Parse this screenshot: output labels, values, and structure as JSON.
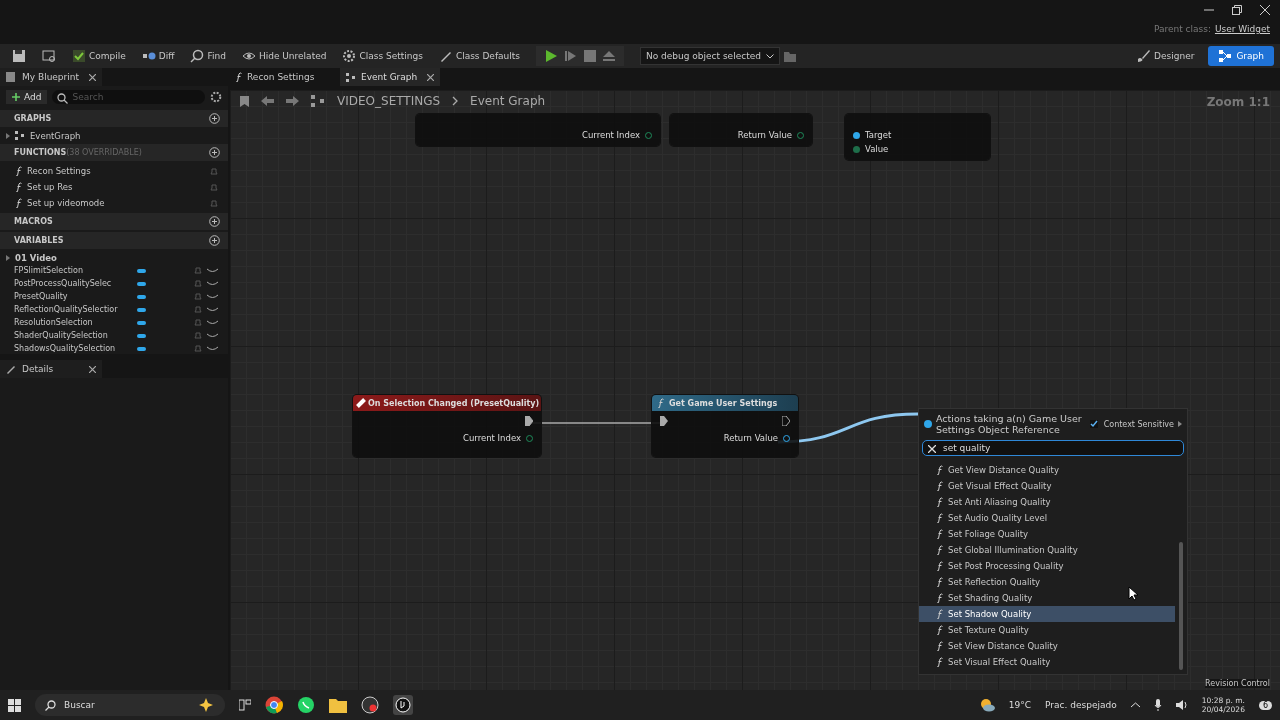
{
  "window": {
    "parent_class_label": "Parent class:",
    "parent_class": "User Widget"
  },
  "toolbar": {
    "buttons": [
      {
        "kind": "save"
      },
      {
        "kind": "browse"
      },
      {
        "kind": "compile",
        "label": "Compile"
      },
      {
        "kind": "diff",
        "label": "Diff"
      },
      {
        "kind": "find",
        "label": "Find"
      },
      {
        "kind": "hide",
        "label": "Hide Unrelated"
      },
      {
        "kind": "settings",
        "label": "Class Settings"
      },
      {
        "kind": "defaults",
        "label": "Class Defaults"
      }
    ],
    "debug_dropdown": "No debug object selected",
    "modes": [
      {
        "label": "Designer",
        "selected": false
      },
      {
        "label": "Graph",
        "selected": true
      }
    ]
  },
  "my_blueprint": {
    "tab": "My Blueprint",
    "add": "Add",
    "search_placeholder": "Search",
    "sections": [
      {
        "title": "GRAPHS",
        "items": [
          {
            "kind": "graph",
            "label": "EventGraph"
          }
        ]
      },
      {
        "title": "FUNCTIONS",
        "note": "(38 OVERRIDABLE)",
        "items": [
          {
            "kind": "function",
            "label": "Recon Settings"
          },
          {
            "kind": "function",
            "label": "Set up Res"
          },
          {
            "kind": "function",
            "label": "Set up videomode"
          }
        ]
      },
      {
        "title": "MACROS"
      },
      {
        "title": "VARIABLES",
        "items": [
          {
            "kind": "category",
            "label": "01 Video"
          },
          {
            "kind": "variable",
            "label": "FPSlimitSelection"
          },
          {
            "kind": "variable",
            "label": "PostProcessQualitySelec"
          },
          {
            "kind": "variable",
            "label": "PresetQuality"
          },
          {
            "kind": "variable",
            "label": "ReflectionQualitySelectior"
          },
          {
            "kind": "variable",
            "label": "ResolutionSelection"
          },
          {
            "kind": "variable",
            "label": "ShaderQualitySelection"
          },
          {
            "kind": "variable",
            "label": "ShadowsQualitySelection"
          }
        ]
      }
    ]
  },
  "details": {
    "tab": "Details"
  },
  "graph_tabs": [
    {
      "label": "Recon Settings",
      "selected": false
    },
    {
      "label": "Event Graph",
      "selected": true
    }
  ],
  "breadcrumb": {
    "blueprint": "VIDEO_SETTINGS",
    "graph": "Event Graph"
  },
  "zoom": "Zoom 1:1",
  "nodes": [
    {
      "kind": "partial",
      "pins": [
        {
          "label": "Current Index",
          "kind": "output"
        }
      ]
    },
    {
      "kind": "partial",
      "pins": [
        {
          "label": "Return Value",
          "kind": "output"
        }
      ]
    },
    {
      "kind": "partial",
      "pins": [
        {
          "label": "Target",
          "kind": "input"
        },
        {
          "label": "Value",
          "kind": "input"
        }
      ]
    },
    {
      "kind": "event",
      "title": "On Selection Changed (PresetQuality)",
      "pins": [
        {
          "label": "Current Index",
          "kind": "output"
        }
      ]
    },
    {
      "kind": "function",
      "title": "Get Game User Settings",
      "pins": [
        {
          "label": "Return Value",
          "kind": "output"
        }
      ]
    }
  ],
  "action_menu": {
    "title": "Actions taking a(n) Game User Settings Object Reference",
    "context_sensitive_label": "Context Sensitive",
    "context_sensitive": true,
    "search": "set quality",
    "items": [
      {
        "label": "Get View Distance Quality",
        "selected": false
      },
      {
        "label": "Get Visual Effect Quality",
        "selected": false
      },
      {
        "label": "Set Anti Aliasing Quality",
        "selected": false
      },
      {
        "label": "Set Audio Quality Level",
        "selected": false
      },
      {
        "label": "Set Foliage Quality",
        "selected": false
      },
      {
        "label": "Set Global Illumination Quality",
        "selected": false
      },
      {
        "label": "Set Post Processing Quality",
        "selected": false
      },
      {
        "label": "Set Reflection Quality",
        "selected": false
      },
      {
        "label": "Set Shading Quality",
        "selected": false
      },
      {
        "label": "Set Shadow Quality",
        "selected": true
      },
      {
        "label": "Set Texture Quality",
        "selected": false
      },
      {
        "label": "Set View Distance Quality",
        "selected": false
      },
      {
        "label": "Set Visual Effect Quality",
        "selected": false
      }
    ]
  },
  "status_bar": {
    "revision_control": "Revision Control"
  },
  "taskbar": {
    "search": "Buscar",
    "weather": "19°C",
    "weather_text": "Prac. despejado",
    "time": "10:28 p. m.",
    "date": "20/04/2026",
    "notifications": "6"
  }
}
